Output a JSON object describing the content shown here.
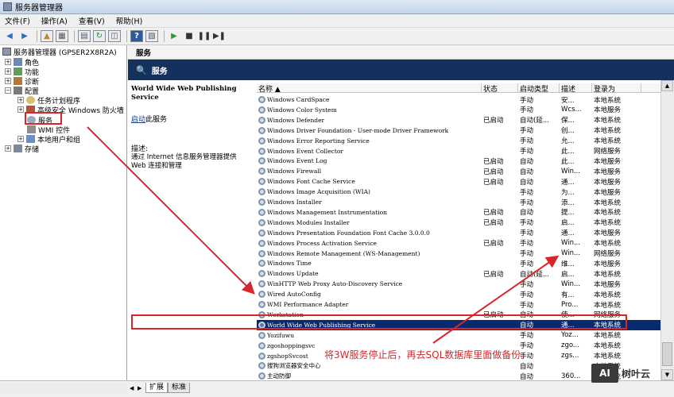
{
  "window": {
    "title": "服务器管理器"
  },
  "menu": [
    "文件(F)",
    "操作(A)",
    "查看(V)",
    "帮助(H)"
  ],
  "tree": {
    "root": "服务器管理器 (GPSER2X8R2A)",
    "items": [
      "角色",
      "功能",
      "诊断",
      "配置",
      "任务计划程序",
      "高级安全 Windows 防火墙",
      "服务",
      "WMI 控件",
      "本地用户和组",
      "存储"
    ]
  },
  "section_header": "服务",
  "panel_title": "服务",
  "detail": {
    "service_name": "World Wide Web Publishing Service",
    "action_link": "启动",
    "action_rest": "此服务",
    "desc_label": "描述:",
    "desc_text": "通过 Internet 信息服务管理器提供 Web 连接和管理"
  },
  "columns": [
    "名称",
    "状态",
    "启动类型",
    "描述",
    "登录为"
  ],
  "services": [
    [
      "Windows CardSpace",
      "",
      "手动",
      "安...",
      "本地系统"
    ],
    [
      "Windows Color System",
      "",
      "手动",
      "Wcs...",
      "本地服务"
    ],
    [
      "Windows Defender",
      "已启动",
      "自动(延...",
      "保...",
      "本地系统"
    ],
    [
      "Windows Driver Foundation - User-mode Driver Framework",
      "",
      "手动",
      "创...",
      "本地系统"
    ],
    [
      "Windows Error Reporting Service",
      "",
      "手动",
      "允...",
      "本地系统"
    ],
    [
      "Windows Event Collector",
      "",
      "手动",
      "此...",
      "网络服务"
    ],
    [
      "Windows Event Log",
      "已启动",
      "自动",
      "此...",
      "本地服务"
    ],
    [
      "Windows Firewall",
      "已启动",
      "自动",
      "Win...",
      "本地服务"
    ],
    [
      "Windows Font Cache Service",
      "已启动",
      "自动",
      "通...",
      "本地服务"
    ],
    [
      "Windows Image Acquisition (WIA)",
      "",
      "手动",
      "为...",
      "本地服务"
    ],
    [
      "Windows Installer",
      "",
      "手动",
      "添...",
      "本地系统"
    ],
    [
      "Windows Management Instrumentation",
      "已启动",
      "自动",
      "提...",
      "本地系统"
    ],
    [
      "Windows Modules Installer",
      "已启动",
      "手动",
      "启...",
      "本地系统"
    ],
    [
      "Windows Presentation Foundation Font Cache 3.0.0.0",
      "",
      "手动",
      "通...",
      "本地服务"
    ],
    [
      "Windows Process Activation Service",
      "已启动",
      "手动",
      "Win...",
      "本地系统"
    ],
    [
      "Windows Remote Management (WS-Management)",
      "",
      "手动",
      "Win...",
      "网络服务"
    ],
    [
      "Windows Time",
      "",
      "手动",
      "维...",
      "本地服务"
    ],
    [
      "Windows Update",
      "已启动",
      "自动(延...",
      "启...",
      "本地系统"
    ],
    [
      "WinHTTP Web Proxy Auto-Discovery Service",
      "",
      "手动",
      "Win...",
      "本地服务"
    ],
    [
      "Wired AutoConfig",
      "",
      "手动",
      "有...",
      "本地系统"
    ],
    [
      "WMI Performance Adapter",
      "",
      "手动",
      "Pro...",
      "本地系统"
    ],
    [
      "Workstation",
      "已启动",
      "自动",
      "使...",
      "网络服务"
    ],
    [
      "World Wide Web Publishing Service",
      "",
      "自动",
      "通...",
      "本地系统"
    ],
    [
      "Yozifuwu",
      "",
      "手动",
      "Yoz...",
      "本地系统"
    ],
    [
      "zgoshoppingsvc",
      "",
      "手动",
      "zgo...",
      "本地系统"
    ],
    [
      "zgshopSvcost",
      "",
      "手动",
      "zgs...",
      "本地系统"
    ],
    [
      "搜狗浏览器安全中心",
      "",
      "自动",
      "",
      "本地系统"
    ],
    [
      "主动防御",
      "",
      "自动",
      "360...",
      "本地系统"
    ]
  ],
  "selected_index": 22,
  "tabs": [
    "扩展",
    "标准"
  ],
  "annotation": "将3W服务停止后，再去SQL数据库里面做备份。",
  "watermark": {
    "logo": "AI",
    "text": "树叶云"
  },
  "colors": {
    "accent_red": "#d9262b",
    "header_navy": "#14315e",
    "selection": "#0a2a6e"
  }
}
